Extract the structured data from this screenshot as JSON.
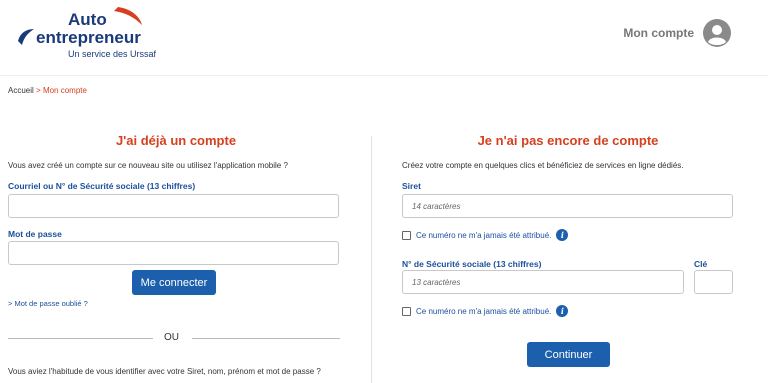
{
  "brand": {
    "line1": "Auto",
    "line2": "entrepreneur",
    "tagline": "Un service des Urssaf"
  },
  "header": {
    "account_label": "Mon compte"
  },
  "breadcrumb": {
    "home": "Accueil",
    "separator": ">",
    "current": "Mon compte"
  },
  "login": {
    "title": "J'ai déjà un compte",
    "intro": "Vous avez créé un compte sur ce nouveau site ou utilisez l'application mobile ?",
    "id_label": "Courriel ou N° de Sécurité sociale (13 chiffres)",
    "id_value": "",
    "password_label": "Mot de passe",
    "password_value": "",
    "submit_label": "Me connecter",
    "forgot_label": "> Mot de passe oublié ?",
    "or_label": "OU",
    "legacy_text": "Vous aviez l'habitude de vous identifier avec votre Siret, nom, prénom et mot de passe ?"
  },
  "signup": {
    "title": "Je n'ai pas encore de compte",
    "intro": "Créez votre compte en quelques clics et bénéficiez de services en ligne dédiés.",
    "siret_label": "Siret",
    "siret_placeholder": "14 caractères",
    "siret_checkbox_label": "Ce numéro ne m'a jamais été attribué.",
    "ssn_label": "N° de Sécurité sociale (13 chiffres)",
    "ssn_placeholder": "13 caractères",
    "key_label": "Clé",
    "key_value": "",
    "ssn_checkbox_label": "Ce numéro ne m'a jamais été attribué.",
    "submit_label": "Continuer"
  },
  "icons": {
    "account": "user-circle-icon",
    "info": "info-icon"
  },
  "colors": {
    "primary_blue": "#1b5fad",
    "accent_red": "#d6401f",
    "brand_navy": "#1a3a7a"
  }
}
